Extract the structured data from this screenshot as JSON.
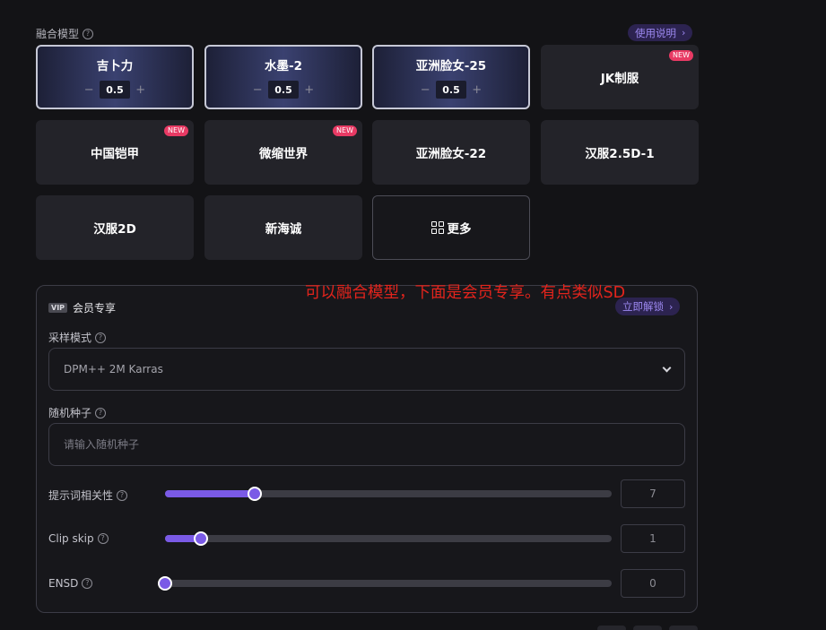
{
  "fusion": {
    "label": "融合模型",
    "guide_link": "使用说明",
    "models": [
      {
        "name": "吉卜力",
        "selected": true,
        "weight": "0.5"
      },
      {
        "name": "水墨-2",
        "selected": true,
        "weight": "0.5"
      },
      {
        "name": "亚洲脸女-25",
        "selected": true,
        "weight": "0.5"
      },
      {
        "name": "JK制服",
        "badge": "NEW"
      },
      {
        "name": "中国铠甲",
        "badge": "NEW"
      },
      {
        "name": "微缩世界",
        "badge": "NEW"
      },
      {
        "name": "亚洲脸女-22"
      },
      {
        "name": "汉服2.5D-1"
      },
      {
        "name": "汉服2D"
      },
      {
        "name": "新海诚"
      }
    ],
    "more_label": "更多"
  },
  "annotation": "可以融合模型，下面是会员专享。有点类似SD",
  "vip": {
    "tag": "VIP",
    "title": "会员专享",
    "unlock_link": "立即解锁",
    "sampler": {
      "label": "采样模式",
      "value": "DPM++ 2M Karras"
    },
    "seed": {
      "label": "随机种子",
      "placeholder": "请输入随机种子"
    },
    "sliders": [
      {
        "label": "提示词相关性",
        "value": "7",
        "level": 0.2
      },
      {
        "label": "Clip skip",
        "value": "1",
        "level": 0.08
      },
      {
        "label": "ENSD",
        "value": "0",
        "level": 0.0
      }
    ]
  },
  "icons": {
    "help": "question-circle-icon",
    "more": "grid-icon",
    "select": "chevron-down-icon",
    "link": "chevron-right-icon"
  },
  "colors": {
    "accent": "#7a5ae6",
    "annotation": "#e3241c",
    "badge": "#e83a64",
    "background": "#131316"
  }
}
